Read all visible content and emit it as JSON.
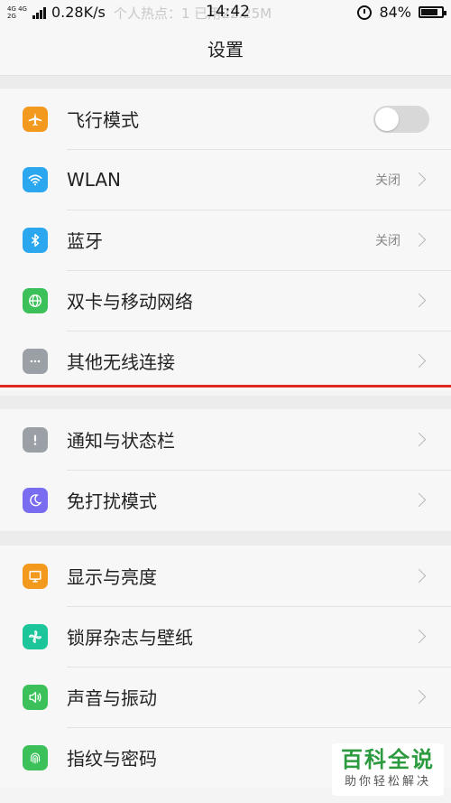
{
  "status_bar": {
    "network_tag_top": "4G 4G",
    "network_tag_bottom": "2G",
    "speed": "0.28K/s",
    "ghost_text": "个人热点：1 已用22.25M",
    "time": "14:42",
    "battery": "84%"
  },
  "header": {
    "title": "设置"
  },
  "colors": {
    "airplane": "#f39a1e",
    "wlan": "#2aa7ef",
    "bluetooth": "#2aa7ef",
    "mobile_network": "#3cc15a",
    "other_wireless": "#9aa0a6",
    "notifications": "#9aa0a6",
    "do_not_disturb": "#7a6cf0",
    "display": "#f39a1e",
    "lockscreen": "#1dc59a",
    "sound": "#3cc15a",
    "fingerprint": "#3cc15a",
    "highlight_line": "#e0281e"
  },
  "groups": [
    {
      "items": [
        {
          "label": "飞行模式",
          "icon": "airplane-icon",
          "control": "toggle",
          "toggle_on": false
        },
        {
          "label": "WLAN",
          "icon": "wifi-icon",
          "status": "关闭"
        },
        {
          "label": "蓝牙",
          "icon": "bluetooth-icon",
          "status": "关闭"
        },
        {
          "label": "双卡与移动网络",
          "icon": "globe-icon"
        },
        {
          "label": "其他无线连接",
          "icon": "more-dots-icon"
        }
      ]
    },
    {
      "items": [
        {
          "label": "通知与状态栏",
          "icon": "exclamation-icon"
        },
        {
          "label": "免打扰模式",
          "icon": "moon-icon"
        }
      ]
    },
    {
      "items": [
        {
          "label": "显示与亮度",
          "icon": "monitor-icon"
        },
        {
          "label": "锁屏杂志与壁纸",
          "icon": "pinwheel-icon"
        },
        {
          "label": "声音与振动",
          "icon": "speaker-icon"
        },
        {
          "label": "指纹与密码",
          "icon": "fingerprint-icon"
        }
      ]
    }
  ],
  "watermark": {
    "main": "百科全说",
    "sub": "助你轻松解决"
  }
}
